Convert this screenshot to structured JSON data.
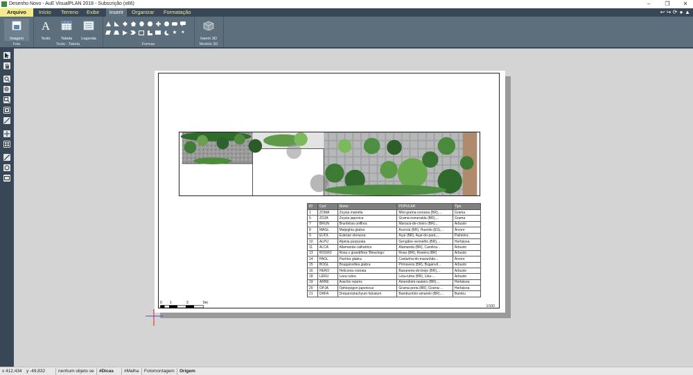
{
  "window": {
    "title": "Desenho Novo - AuE VisualPLAN 2018 - Subscrição (x86)"
  },
  "menubar": {
    "items": [
      {
        "label": "Arquivo"
      },
      {
        "label": "Início"
      },
      {
        "label": "Terreno"
      },
      {
        "label": "Exibir"
      },
      {
        "label": "Inserir"
      },
      {
        "label": "Organizar"
      },
      {
        "label": "Formatação"
      }
    ]
  },
  "ribbon": {
    "groups": {
      "foto": {
        "label": "Foto",
        "imagem": "Imagem"
      },
      "texto_tabela": {
        "label": "Texto - Tabela",
        "texto": "Texto",
        "tabela": "Tabela",
        "legenda": "Legenda"
      },
      "formas": {
        "label": "Formas"
      },
      "modelo3d": {
        "label": "Modelo 3D",
        "inserir3d": "Inserir 3D"
      }
    }
  },
  "plant_table": {
    "headers": [
      "ID",
      "Cod",
      "Nome",
      "POPULAR",
      "Tipo"
    ],
    "rows": [
      [
        "1",
        "ZOMA",
        "Zoysia matrella",
        "Mini-grama-coreana (BR),...",
        "Grama"
      ],
      [
        "5",
        "ZOJA",
        "Zoysia japonica",
        "Grama-esmeralda (BR),...",
        "Grama"
      ],
      [
        "7",
        "BRUN",
        "Brunfelsia uniflora",
        "Manacá-de-cheiro (BR),...",
        "Arbusto"
      ],
      [
        "8",
        "MAGL",
        "Malpighia glabra",
        "Acerola (BR), Huesito (ES),...",
        "Árvore"
      ],
      [
        "9",
        "EUOL",
        "Euterpe oleracea",
        "Açaí (BR), Açaí-do-pará,...",
        "Palmeira"
      ],
      [
        "10",
        "ALPU",
        "Alpinia purpurata",
        "Gengibre-vermelho (BR),...",
        "Herbácea"
      ],
      [
        "11",
        "ALCA",
        "Allamanda cathartica",
        "Alamanda (BR), Carolina...",
        "Arbusto"
      ],
      [
        "13",
        "ROGR2",
        "Rosa x grandiflora 'Blessings'",
        "Rosa (BR), Roseira (BR)",
        "Arbusto"
      ],
      [
        "14",
        "PAGL",
        "Pachira glabra",
        "Castanha-do-maranhão...",
        "Árvore"
      ],
      [
        "15",
        "BOGL",
        "Bougainvillea glabra",
        "Primavera (BR), Buganvíl...",
        "Arbusto"
      ],
      [
        "16",
        "HERO",
        "Heliconia rostrata",
        "Bananeira-do-brejo (BR),...",
        "Arbusto"
      ],
      [
        "18",
        "LERU",
        "Leea rubra",
        "Léia-rubra (BR), Léia-...",
        "Arbusto"
      ],
      [
        "19",
        "ARRE",
        "Arachis repens",
        "Amendoim-rasteiro (BR),...",
        "Herbácea"
      ],
      [
        "20",
        "OPJA",
        "Ophiopogon japonicus",
        "Grama-preta (BR), Grama-...",
        "Herbácea"
      ],
      [
        "21",
        "DRFA",
        "Drepanostachyum falcatum",
        "Bambuzinho-amarelo (BR),...",
        "Bambu"
      ]
    ]
  },
  "scale_bar": {
    "labels": [
      "0",
      "1",
      "3",
      "5m"
    ]
  },
  "drawing_scale": "1/100",
  "statusbar": {
    "x": "x 412,434",
    "y": "y -49,832",
    "selection": "nenhum objeto se",
    "dicas": "#Dicas",
    "malha": "#Malha",
    "fotomontagem": "Fotomontagem",
    "origem": "Origem"
  }
}
